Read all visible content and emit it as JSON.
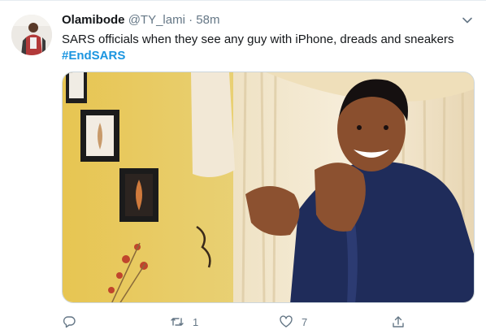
{
  "tweet": {
    "author_name": "Olamibode",
    "author_handle": "@TY_lami",
    "separator": "·",
    "timestamp": "58m",
    "text": "SARS officials when they see any guy with iPhone, dreads and sneakers",
    "hashtag": "#EndSARS"
  },
  "actions": {
    "reply_count": "",
    "retweet_count": "1",
    "like_count": "7",
    "share_count": ""
  },
  "icons": {
    "more": "chevron-down-icon",
    "reply": "reply-icon",
    "retweet": "retweet-icon",
    "like": "heart-icon",
    "share": "share-icon"
  },
  "colors": {
    "text": "#14171a",
    "secondary": "#657786",
    "link": "#1b95e0",
    "border": "#ccd6dd"
  }
}
